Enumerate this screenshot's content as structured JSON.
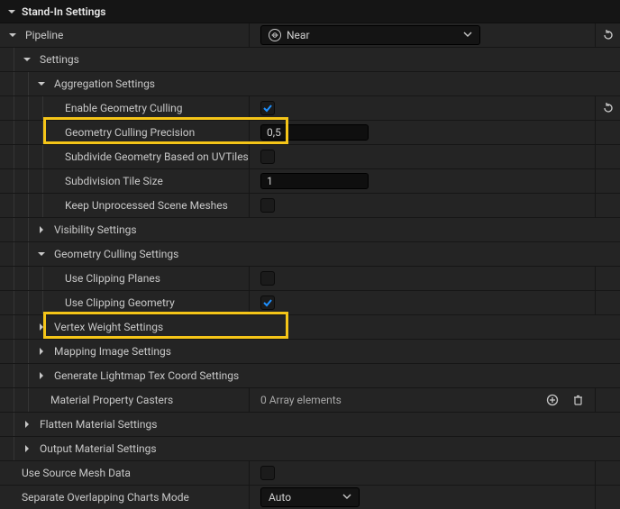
{
  "header": {
    "title": "Stand-In Settings"
  },
  "pipeline": {
    "label": "Pipeline",
    "dropdown_value": "Near"
  },
  "settings": {
    "label": "Settings",
    "aggregation": {
      "label": "Aggregation Settings",
      "enable_geometry_culling": {
        "label": "Enable Geometry Culling",
        "checked": true
      },
      "geometry_culling_precision": {
        "label": "Geometry Culling Precision",
        "value": "0,5"
      },
      "subdivide_uv_tiles": {
        "label": "Subdivide Geometry Based on UVTiles",
        "checked": false
      },
      "subdivision_tile_size": {
        "label": "Subdivision Tile Size",
        "value": "1"
      },
      "keep_unprocessed_meshes": {
        "label": "Keep Unprocessed Scene Meshes",
        "checked": false
      }
    },
    "visibility": {
      "label": "Visibility Settings"
    },
    "geometry_culling": {
      "label": "Geometry Culling Settings",
      "use_clipping_planes": {
        "label": "Use Clipping Planes",
        "checked": false
      },
      "use_clipping_geometry": {
        "label": "Use Clipping Geometry",
        "checked": true
      }
    },
    "vertex_weight": {
      "label": "Vertex Weight Settings"
    },
    "mapping_image": {
      "label": "Mapping Image Settings"
    },
    "lightmap_tex_coord": {
      "label": "Generate Lightmap Tex Coord Settings"
    },
    "material_property_casters": {
      "label": "Material Property Casters",
      "value": "0 Array elements"
    }
  },
  "flatten_material": {
    "label": "Flatten Material Settings"
  },
  "output_material": {
    "label": "Output Material Settings"
  },
  "use_source_mesh_data": {
    "label": "Use Source Mesh Data",
    "checked": false
  },
  "overlapping_charts_mode": {
    "label": "Separate Overlapping Charts Mode",
    "value": "Auto"
  }
}
